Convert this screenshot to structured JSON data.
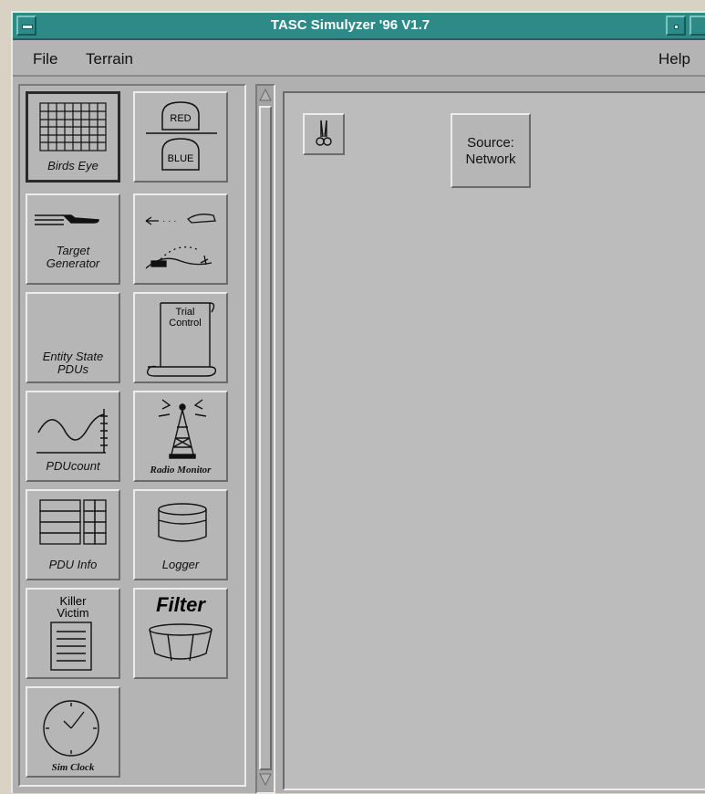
{
  "window": {
    "title": "TASC Simulyzer '96 V1.7"
  },
  "menu": {
    "file": "File",
    "terrain": "Terrain",
    "help": "Help"
  },
  "tools": {
    "birds_eye": "Birds Eye",
    "red_label": "RED",
    "blue_label": "BLUE",
    "target_gen_line1": "Target",
    "target_gen_line2": "Generator",
    "entity_state_line1": "Entity State",
    "entity_state_line2": "PDUs",
    "trial_control_line1": "Trial",
    "trial_control_line2": "Control",
    "pdu_count": "PDUcount",
    "radio_monitor": "Radio Monitor",
    "pdu_info": "PDU Info",
    "logger": "Logger",
    "killer_victim_line1": "Killer",
    "killer_victim_line2": "Victim",
    "filter": "Filter",
    "sim_clock": "Sim Clock"
  },
  "canvas": {
    "source_line1": "Source:",
    "source_line2": "Network"
  },
  "colors": {
    "titlebar": "#2d8a87",
    "panel": "#b4b4b4",
    "background": "#d9d2c4"
  }
}
